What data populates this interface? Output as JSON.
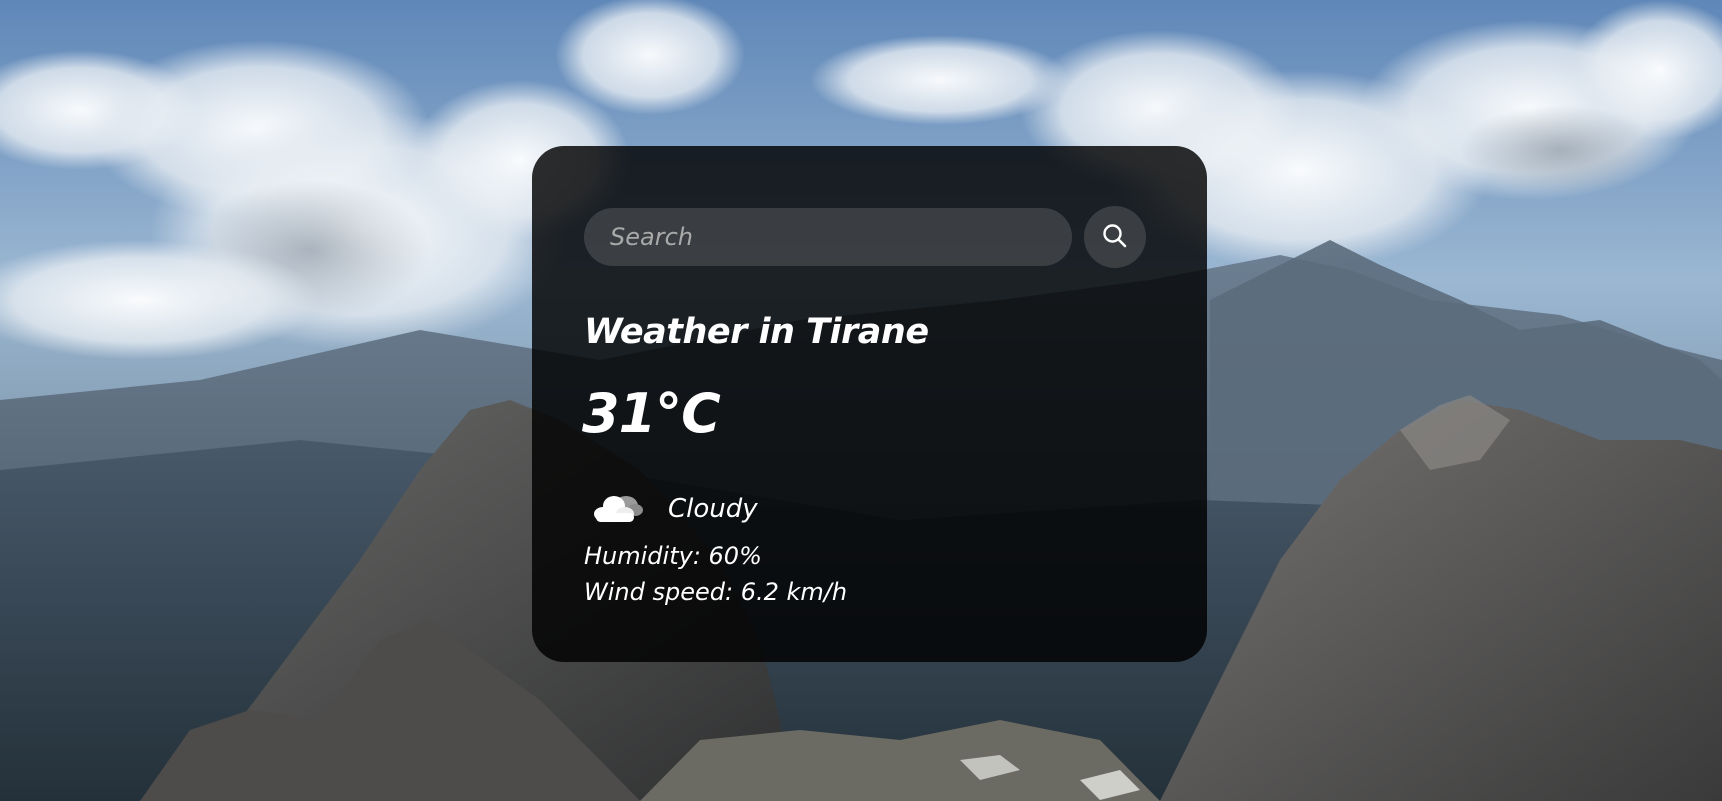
{
  "search": {
    "placeholder": "Search",
    "value": ""
  },
  "weather": {
    "city_title": "Weather in Tirane",
    "temperature": "31°C",
    "condition": "Cloudy",
    "condition_icon": "cloud-icon",
    "humidity": "Humidity: 60%",
    "wind_speed": "Wind speed: 6.2 km/h"
  },
  "icons": {
    "search": "search-icon"
  },
  "colors": {
    "card_background": "#000000",
    "text": "#ffffff",
    "input_background": "#5a5a5a",
    "placeholder": "#a9a9a9"
  }
}
